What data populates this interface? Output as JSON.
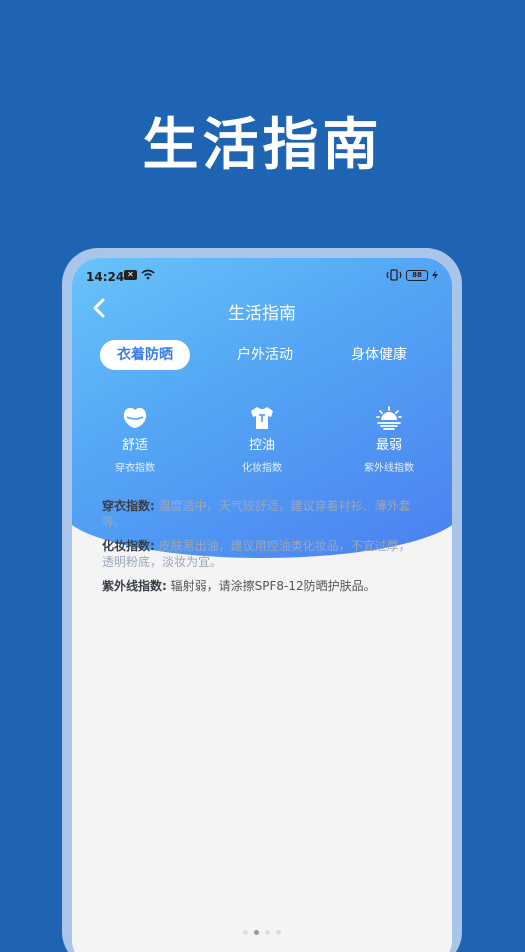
{
  "promo": {
    "title": "生活指南"
  },
  "status_bar": {
    "time": "14:24",
    "battery": "88"
  },
  "nav": {
    "title": "生活指南"
  },
  "tabs": [
    {
      "label": "衣着防晒",
      "active": true
    },
    {
      "label": "户外活动",
      "active": false
    },
    {
      "label": "身体健康",
      "active": false
    }
  ],
  "indexes": [
    {
      "value": "舒适",
      "label": "穿衣指数",
      "icon": "lips-icon"
    },
    {
      "value": "控油",
      "label": "化妆指数",
      "icon": "shirt-icon"
    },
    {
      "value": "最弱",
      "label": "紫外线指数",
      "icon": "sun-icon"
    }
  ],
  "details": [
    {
      "label": "穿衣指数:",
      "text": "温度适中，天气较舒适，建议穿着衬衫、薄外套等。"
    },
    {
      "label": "化妆指数:",
      "text": "皮肤易出油，建议用控油类化妆品，不宜过厚，透明粉底，淡妆为宜。"
    },
    {
      "label": "紫外线指数:",
      "text": "辐射弱，请涂擦SPF8-12防晒护肤品。"
    }
  ],
  "colors": {
    "background": "#1E64B2",
    "accent": "#3A7DE8",
    "frame": "#A9C5EA"
  }
}
